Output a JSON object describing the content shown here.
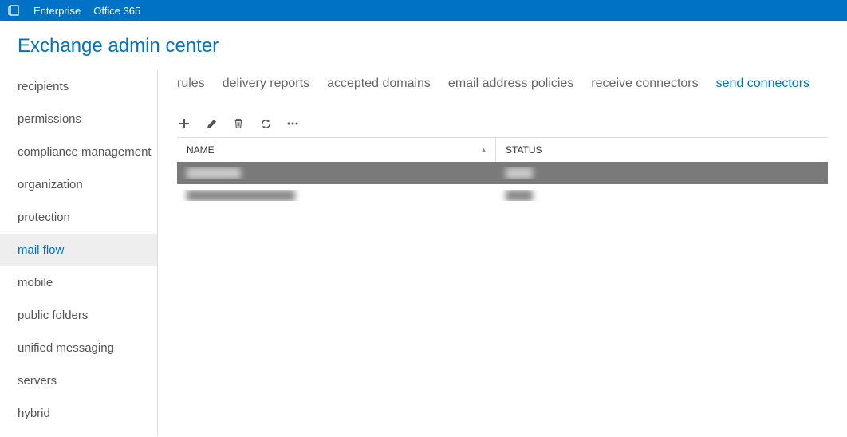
{
  "topbar": {
    "link_enterprise": "Enterprise",
    "link_office365": "Office 365"
  },
  "page_title": "Exchange admin center",
  "sidebar": {
    "items": [
      {
        "label": "recipients",
        "active": false
      },
      {
        "label": "permissions",
        "active": false
      },
      {
        "label": "compliance management",
        "active": false
      },
      {
        "label": "organization",
        "active": false
      },
      {
        "label": "protection",
        "active": false
      },
      {
        "label": "mail flow",
        "active": true
      },
      {
        "label": "mobile",
        "active": false
      },
      {
        "label": "public folders",
        "active": false
      },
      {
        "label": "unified messaging",
        "active": false
      },
      {
        "label": "servers",
        "active": false
      },
      {
        "label": "hybrid",
        "active": false
      }
    ]
  },
  "tabs": [
    {
      "label": "rules",
      "active": false
    },
    {
      "label": "delivery reports",
      "active": false
    },
    {
      "label": "accepted domains",
      "active": false
    },
    {
      "label": "email address policies",
      "active": false
    },
    {
      "label": "receive connectors",
      "active": false
    },
    {
      "label": "send connectors",
      "active": true
    }
  ],
  "toolbar": {
    "new_label": "New",
    "edit_label": "Edit",
    "delete_label": "Delete",
    "refresh_label": "Refresh",
    "more_label": "More"
  },
  "table": {
    "columns": {
      "name": "NAME",
      "status": "STATUS"
    },
    "sort_indicator": "▲",
    "rows": [
      {
        "name": "████████",
        "status": "████",
        "selected": true
      },
      {
        "name": "████████████████",
        "status": "████",
        "selected": false
      }
    ]
  }
}
